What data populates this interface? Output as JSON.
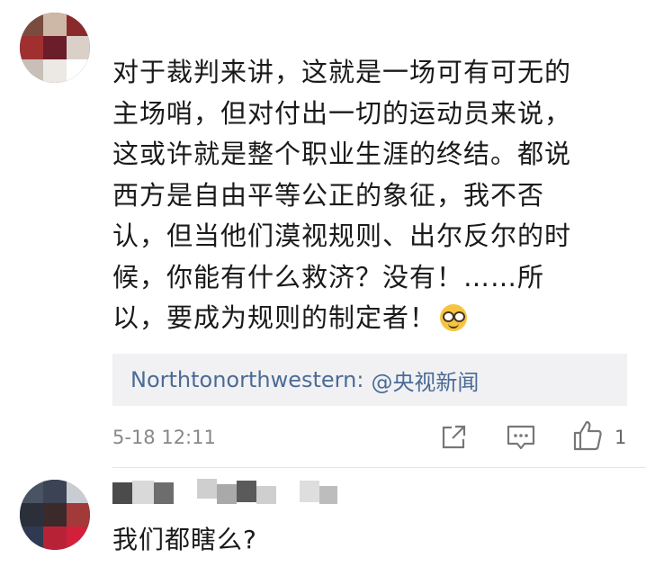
{
  "comment1": {
    "avatar": "blurred-avatar",
    "lines": [
      "对于裁判来讲，这就是一场可有可无的",
      "主场哨，但对付出一切的运动员来说，",
      "这或许就是整个职业生涯的终结。都说",
      "西方是自由平等公正的象征，我不否",
      "认，但当他们漠视规则、出尔反尔的时",
      "候，你能有什么救济？没有！……所",
      "以，要成为规则的制定者！"
    ],
    "emoji": "nerd-face-emoji",
    "quote": {
      "user": "Northtonorthwestern",
      "colon": ":",
      "mention": "@央视新闻"
    },
    "time": "5-18 12:11",
    "icons": {
      "share": "share-icon",
      "comment": "comment-icon",
      "like": "thumbs-up-icon"
    },
    "like_count": "1",
    "colors": {
      "link": "#4b6b96",
      "quote_bg": "#f1f1f3",
      "meta": "#888888"
    }
  },
  "comment2": {
    "avatar": "blurred-avatar",
    "text": "我们都瞎么?"
  }
}
